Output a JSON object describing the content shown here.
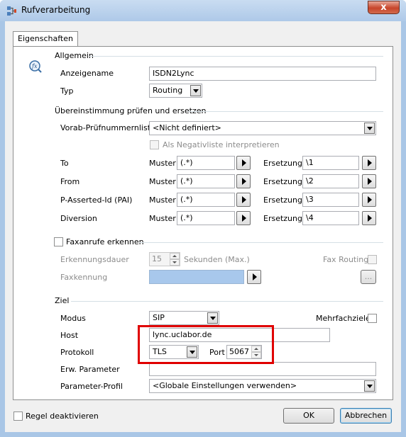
{
  "window": {
    "title": "Rufverarbeitung",
    "close_label": "x"
  },
  "tabs": [
    {
      "label": "Eigenschaften"
    }
  ],
  "allgemein": {
    "section_label": "Allgemein",
    "anzeigename_label": "Anzeigename",
    "anzeigename_value": "ISDN2Lync",
    "typ_label": "Typ",
    "typ_value": "Routing"
  },
  "ersetzen": {
    "section_label": "Übereinstimmung prüfen und ersetzen",
    "vorab_label": "Vorab-Prüfnummernliste",
    "vorab_value": "<Nicht definiert>",
    "negativliste_label": "Als Negativliste interpretieren",
    "muster_label": "Muster",
    "ersetzung_label": "Ersetzung",
    "rows": [
      {
        "name": "To",
        "muster": "(.*)",
        "ersetzung": "\\1"
      },
      {
        "name": "From",
        "muster": "(.*)",
        "ersetzung": "\\2"
      },
      {
        "name": "P-Asserted-Id (PAI)",
        "muster": "(.*)",
        "ersetzung": "\\3"
      },
      {
        "name": "Diversion",
        "muster": "(.*)",
        "ersetzung": "\\4"
      }
    ]
  },
  "fax": {
    "section_label": "Faxanrufe erkennen",
    "dauer_label": "Erkennungsdauer",
    "dauer_value": "15",
    "sekunden_label": "Sekunden (Max.)",
    "routing_label": "Fax Routing",
    "kennung_label": "Faxkennung",
    "browse_label": "..."
  },
  "ziel": {
    "section_label": "Ziel",
    "modus_label": "Modus",
    "modus_value": "SIP",
    "mehrfach_label": "Mehrfachziele",
    "host_label": "Host",
    "host_value": "lync.uclabor.de",
    "protokoll_label": "Protokoll",
    "protokoll_value": "TLS",
    "port_label": "Port",
    "port_value": "5067",
    "erw_label": "Erw. Parameter",
    "erw_value": "",
    "profil_label": "Parameter-Profil",
    "profil_value": "<Globale Einstellungen verwenden>"
  },
  "footer": {
    "deaktivieren_label": "Regel deaktivieren",
    "ok_label": "OK",
    "cancel_label": "Abbrechen"
  },
  "colors": {
    "highlight": "#e00000",
    "title_bar": "#aec9e8"
  }
}
